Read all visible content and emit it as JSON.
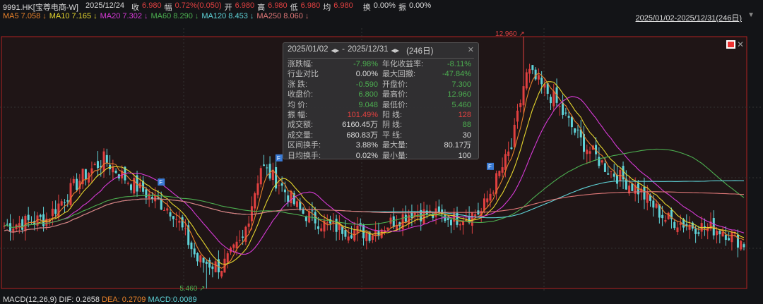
{
  "header": {
    "symbol": "9991.HK[宝尊电商-W]",
    "date": "2025/12/24",
    "close_label": "收",
    "close": "6.980",
    "chg_label": "幅",
    "chg": "0.72%(0.050)",
    "open_label": "开",
    "open": "6.980",
    "high_label": "高",
    "high": "6.980",
    "low_label": "低",
    "low": "6.980",
    "avg_label": "均",
    "avg": "6.980",
    "turnover_label": "换",
    "turnover": "0.00%",
    "amp_label": "振",
    "amp": "0.00%"
  },
  "ma": [
    {
      "label": "MA5 7.058 ↓",
      "color": "#e8822a"
    },
    {
      "label": "MA10 7.165 ↓",
      "color": "#e6d62e"
    },
    {
      "label": "MA20 7.302 ↓",
      "color": "#d63ad6"
    },
    {
      "label": "MA60 8.290 ↓",
      "color": "#4caf50"
    },
    {
      "label": "MA120 8.453 ↓",
      "color": "#5fd3d8"
    },
    {
      "label": "MA250 8.060 ↓",
      "color": "#e07878"
    }
  ],
  "range_selector": "2025/01/02-2025/12/31(246日)",
  "popup": {
    "start": "2025/01/02",
    "end": "2025/12/31",
    "days": "(246日)",
    "sep": "-",
    "rows": [
      [
        "涨跌幅:",
        "-7.98%",
        "g",
        "年化收益率:",
        "-8.11%",
        "g"
      ],
      [
        "行业对比",
        "0.00%",
        "w",
        "最大回撤:",
        "-47.84%",
        "g"
      ],
      [
        "涨  跌:",
        "-0.590",
        "g",
        "开盘价:",
        "7.300",
        "g"
      ],
      [
        "收盘价:",
        "6.800",
        "g",
        "最高价:",
        "12.960",
        "g"
      ],
      [
        "均  价:",
        "9.048",
        "g",
        "最低价:",
        "5.460",
        "g"
      ],
      [
        "振  幅:",
        "101.49%",
        "r",
        "阳  线:",
        "128",
        "r"
      ],
      [
        "成交额:",
        "6160.45万",
        "w",
        "阴  线:",
        "88",
        "g"
      ],
      [
        "成交量:",
        "680.83万",
        "w",
        "平  线:",
        "30",
        "w"
      ],
      [
        "区间换手:",
        "3.88%",
        "w",
        "最大量:",
        "80.17万",
        "w"
      ],
      [
        "日均换手:",
        "0.02%",
        "w",
        "最小量:",
        "100",
        "w"
      ]
    ]
  },
  "macd": {
    "label": "MACD(12,26,9)",
    "dif": "DIF: 0.2658",
    "dea": "DEA: 0.2709",
    "macd": "MACD:0.0089"
  },
  "chart_data": {
    "type": "candlestick",
    "days": 246,
    "price_range": [
      5.46,
      12.96
    ],
    "high_label": "12.960",
    "low_label": "5.460",
    "flag_label": "F",
    "flag_days": [
      52,
      91,
      161
    ],
    "close_keypoints": [
      [
        0,
        7.33
      ],
      [
        14,
        7.54
      ],
      [
        26,
        8.8
      ],
      [
        33,
        9.3
      ],
      [
        42,
        8.6
      ],
      [
        56,
        7.75
      ],
      [
        64,
        6.3
      ],
      [
        72,
        6.1
      ],
      [
        79,
        6.9
      ],
      [
        85,
        9.1
      ],
      [
        91,
        8.6
      ],
      [
        98,
        7.75
      ],
      [
        107,
        7.33
      ],
      [
        121,
        7.1
      ],
      [
        135,
        7.75
      ],
      [
        149,
        7.54
      ],
      [
        158,
        7.75
      ],
      [
        168,
        9.64
      ],
      [
        173,
        11.95
      ],
      [
        182,
        11.1
      ],
      [
        191,
        9.85
      ],
      [
        200,
        9.0
      ],
      [
        210,
        8.4
      ],
      [
        219,
        7.54
      ],
      [
        228,
        7.33
      ],
      [
        238,
        7.2
      ],
      [
        245,
        6.8
      ]
    ],
    "up_color": "#e04040",
    "down_color": "#5fd3d8"
  }
}
